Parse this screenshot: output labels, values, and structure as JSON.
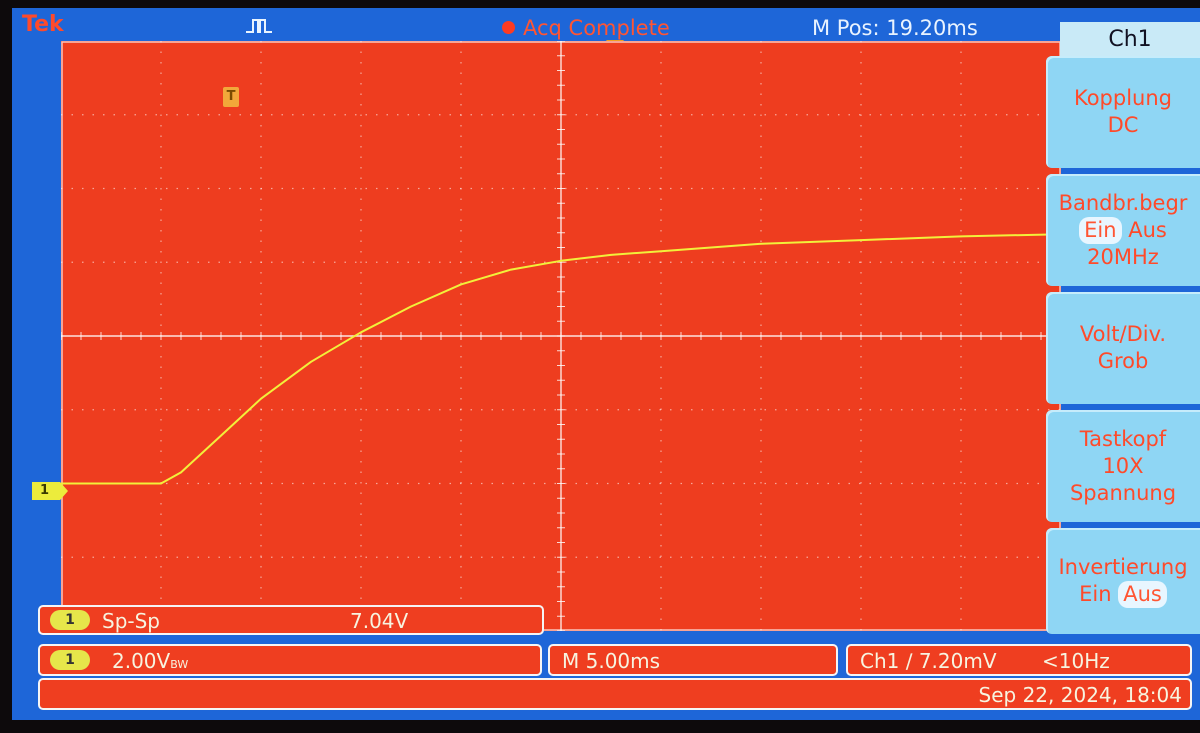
{
  "header": {
    "brand": "Tek",
    "acq_status": "Acq Complete",
    "m_pos": "M Pos: 19.20ms"
  },
  "markers": {
    "trigger": "T",
    "channel": "1"
  },
  "side_menu": {
    "title": "Ch1",
    "coupling": {
      "label": "Kopplung",
      "value": "DC"
    },
    "bandwidth": {
      "label": "Bandbr.begr",
      "opt_on": "Ein",
      "opt_off": "Aus",
      "value": "20MHz"
    },
    "volt_div": {
      "label": "Volt/Div.",
      "value": "Grob"
    },
    "probe": {
      "label": "Tastkopf",
      "value": "10X",
      "type": "Spannung"
    },
    "invert": {
      "label": "Invertierung",
      "opt_on": "Ein",
      "opt_off": "Aus"
    }
  },
  "measurement": {
    "channel": "1",
    "name": "Sp-Sp",
    "value": "7.04V"
  },
  "status": {
    "channel": "1",
    "scale": "2.00V",
    "scale_suffix": "BW",
    "timebase": "M 5.00ms",
    "trigger": "Ch1 ∕ 7.20mV",
    "freq": "<10Hz",
    "datetime": "Sep 22, 2024, 18:04"
  },
  "colors": {
    "screen_bg": "#ee3d1f",
    "trace": "#f2f03a",
    "frame": "#1e66d8",
    "menu_button": "#8fd6f4"
  },
  "chart_data": {
    "type": "line",
    "xlabel": "",
    "ylabel": "",
    "x_divisions": 10,
    "y_divisions": 8,
    "xlim": [
      0,
      10
    ],
    "ylim": [
      -4,
      4
    ],
    "series": [
      {
        "x": [
          0,
          1,
          1.2,
          1.6,
          2,
          2.5,
          3,
          3.5,
          4,
          4.5,
          5,
          5.5,
          6,
          7,
          8,
          9,
          10
        ],
        "y": [
          -2.0,
          -2.0,
          -1.85,
          -1.35,
          -0.85,
          -0.35,
          0.05,
          0.4,
          0.7,
          0.9,
          1.02,
          1.1,
          1.15,
          1.25,
          1.3,
          1.35,
          1.38
        ]
      }
    ]
  }
}
